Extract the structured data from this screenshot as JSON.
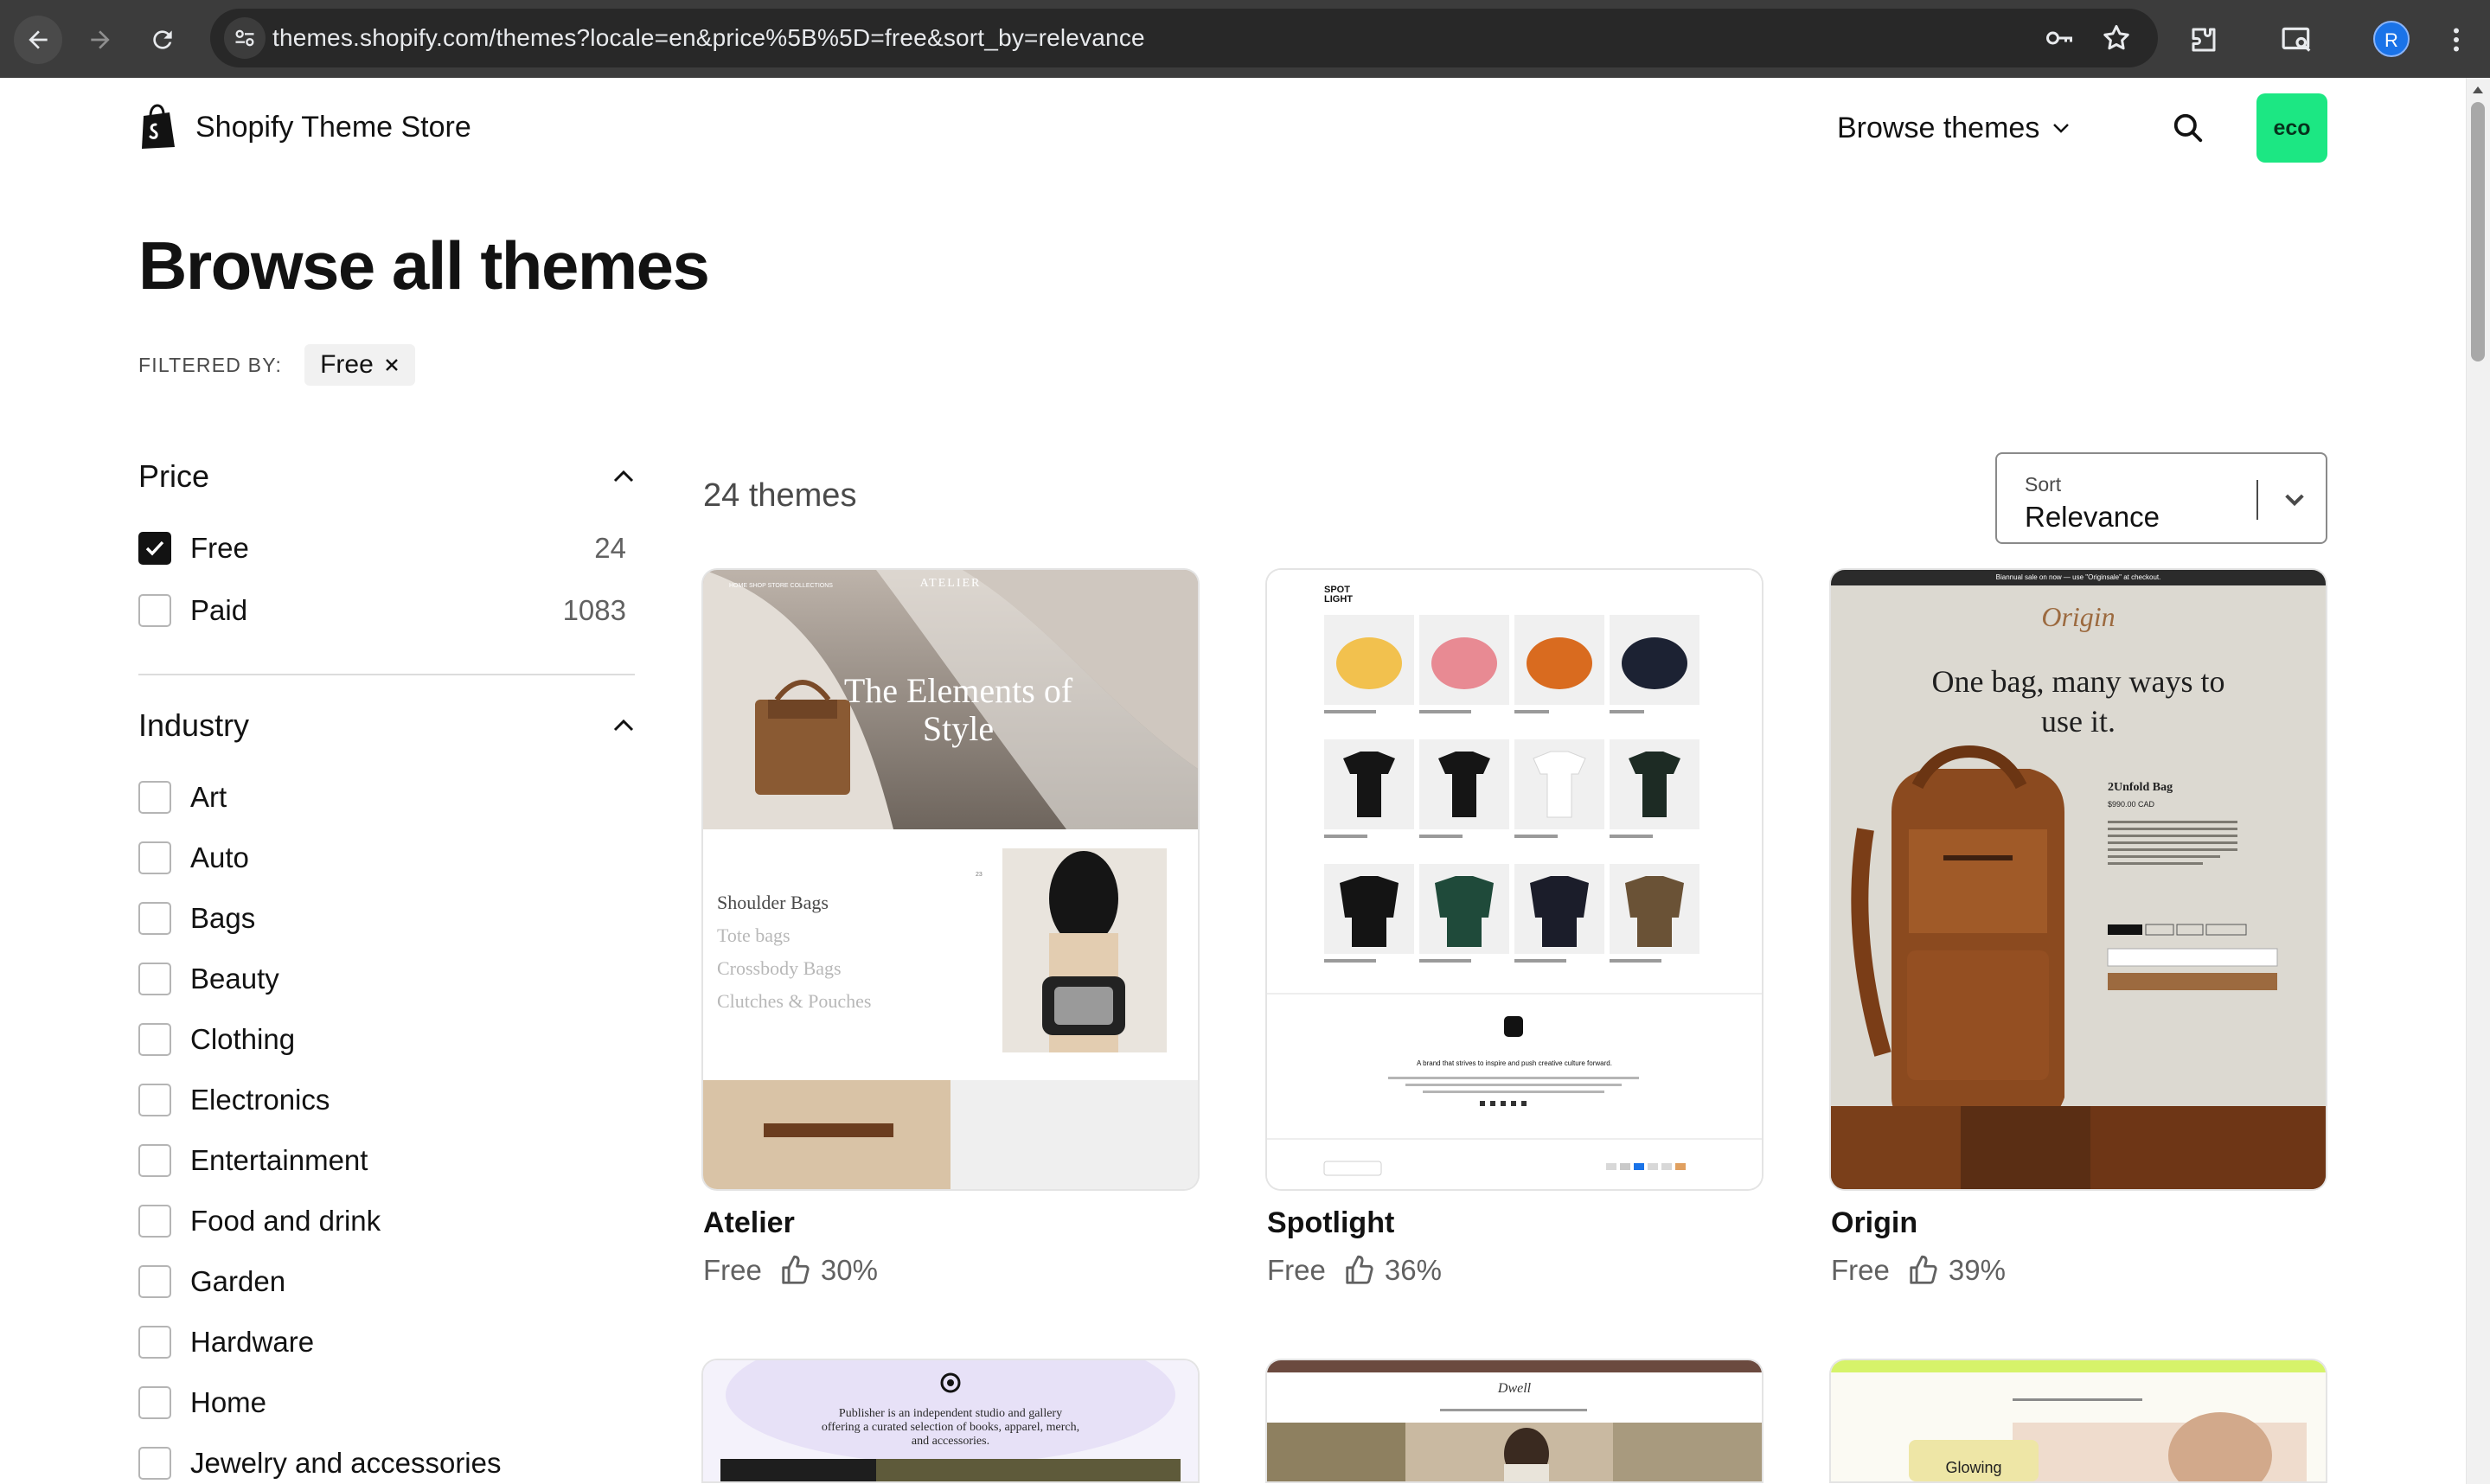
{
  "browser": {
    "url": "themes.shopify.com/themes?locale=en&price%5B%5D=free&sort_by=relevance",
    "profile_initial": "R"
  },
  "header": {
    "brand": "Shopify Theme Store",
    "browse_label": "Browse themes",
    "account_badge": "eco"
  },
  "page": {
    "title": "Browse all themes",
    "filtered_by_label": "FILTERED BY:",
    "active_filter": "Free"
  },
  "filters": {
    "price": {
      "title": "Price",
      "options": [
        {
          "label": "Free",
          "count": "24",
          "checked": true
        },
        {
          "label": "Paid",
          "count": "1083",
          "checked": false
        }
      ]
    },
    "industry": {
      "title": "Industry",
      "options": [
        {
          "label": "Art"
        },
        {
          "label": "Auto"
        },
        {
          "label": "Bags"
        },
        {
          "label": "Beauty"
        },
        {
          "label": "Clothing"
        },
        {
          "label": "Electronics"
        },
        {
          "label": "Entertainment"
        },
        {
          "label": "Food and drink"
        },
        {
          "label": "Garden"
        },
        {
          "label": "Hardware"
        },
        {
          "label": "Home"
        },
        {
          "label": "Jewelry and accessories"
        }
      ]
    }
  },
  "results": {
    "count_label": "24 themes",
    "sort_label": "Sort",
    "sort_value": "Relevance"
  },
  "themes": [
    {
      "name": "Atelier",
      "price": "Free",
      "rating": "30%",
      "preview": {
        "logo": "ATELIER",
        "hero": "The Elements of Style",
        "menu": [
          "Shoulder Bags",
          "Tote bags",
          "Crossbody Bags",
          "Clutches & Pouches"
        ]
      }
    },
    {
      "name": "Spotlight",
      "price": "Free",
      "rating": "36%",
      "preview": {
        "logo": "SPOT LIGHT",
        "tagline": "A brand that strives to inspire and push creative culture forward."
      }
    },
    {
      "name": "Origin",
      "price": "Free",
      "rating": "39%",
      "preview": {
        "banner": "Biannual sale on now — use \"Originsale\" at checkout.",
        "logo": "Origin",
        "hero": "One bag, many ways to use it.",
        "product": "2Unfold Bag",
        "price": "$990.00 CAD"
      }
    }
  ],
  "more_themes": [
    {
      "preview_text": "Publisher is an independent studio and gallery offering a curated selection of books, apparel, merch, and accessories."
    },
    {
      "preview_text": "Dwell"
    },
    {
      "preview_text": "Glowing"
    }
  ],
  "colors": {
    "accent": "#1ce783",
    "chrome": "#3c3c3c",
    "omnibox": "#282828"
  }
}
